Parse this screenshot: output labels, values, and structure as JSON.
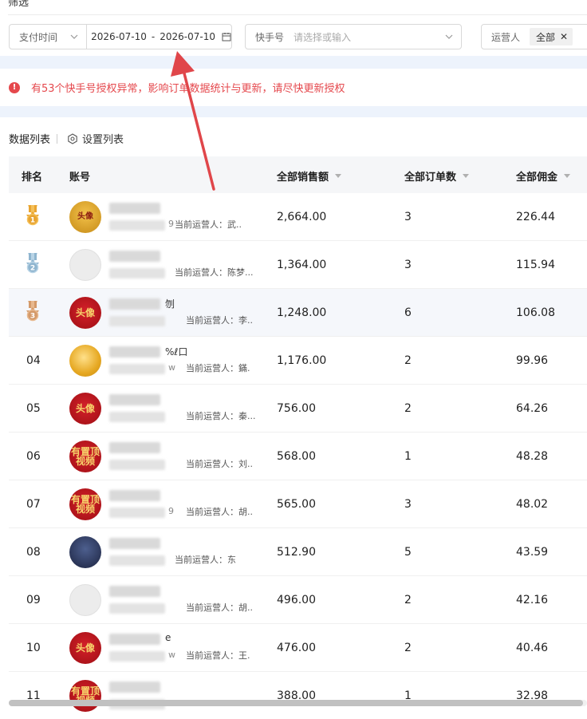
{
  "page": {
    "title": "筛选"
  },
  "filters": {
    "pay_time_label": "支付时间",
    "date_start": "2026-07-10",
    "date_sep": "-",
    "date_end": "2026-07-10",
    "kuaishou_label": "快手号",
    "kuaishou_placeholder": "请选择或输入",
    "operator_label": "运营人",
    "operator_tag": "全部"
  },
  "alert": {
    "text": "有53个快手号授权异常，影响订单数据统计与更新，请尽快更新授权"
  },
  "list": {
    "title": "数据列表",
    "settings_label": "设置列表"
  },
  "table": {
    "headers": {
      "rank": "排名",
      "account": "账号",
      "sales": "全部销售额",
      "orders": "全部订单数",
      "commission": "全部佣金"
    },
    "rows": [
      {
        "rank": "1",
        "name_suffix": "",
        "id_suffix": "9",
        "operator": "当前运营人：武..",
        "sales": "2,664.00",
        "orders": "3",
        "commission": "226.44",
        "avatar": "头像"
      },
      {
        "rank": "2",
        "name_suffix": "",
        "id_suffix": "",
        "operator": "当前运营人：陈梦...",
        "sales": "1,364.00",
        "orders": "3",
        "commission": "115.94",
        "avatar": ""
      },
      {
        "rank": "3",
        "name_suffix": "刎",
        "id_suffix": "",
        "operator": "当前运营人：李..",
        "sales": "1,248.00",
        "orders": "6",
        "commission": "106.08",
        "avatar": "头像"
      },
      {
        "rank": "04",
        "name_suffix": "%ℓ口",
        "id_suffix": "w",
        "operator": "当前运营人：鏋.",
        "sales": "1,176.00",
        "orders": "2",
        "commission": "99.96",
        "avatar": ""
      },
      {
        "rank": "05",
        "name_suffix": "",
        "id_suffix": "",
        "operator": "当前运营人：秦...",
        "sales": "756.00",
        "orders": "2",
        "commission": "64.26",
        "avatar": "头像"
      },
      {
        "rank": "06",
        "name_suffix": "",
        "id_suffix": "",
        "operator": "当前运营人：刘..",
        "sales": "568.00",
        "orders": "1",
        "commission": "48.28",
        "avatar": "有置顶视频"
      },
      {
        "rank": "07",
        "name_suffix": "",
        "id_suffix": "9",
        "operator": "当前运营人：胡..",
        "sales": "565.00",
        "orders": "3",
        "commission": "48.02",
        "avatar": "有置顶视频"
      },
      {
        "rank": "08",
        "name_suffix": "",
        "id_suffix": "",
        "operator": "当前运营人：东",
        "sales": "512.90",
        "orders": "5",
        "commission": "43.59",
        "avatar": ""
      },
      {
        "rank": "09",
        "name_suffix": "",
        "id_suffix": "",
        "operator": "当前运营人：胡..",
        "sales": "496.00",
        "orders": "2",
        "commission": "42.16",
        "avatar": ""
      },
      {
        "rank": "10",
        "name_suffix": "e",
        "id_suffix": "w",
        "operator": "当前运营人：王.",
        "sales": "476.00",
        "orders": "2",
        "commission": "40.46",
        "avatar": "头像"
      },
      {
        "rank": "11",
        "name_suffix": "",
        "id_suffix": "",
        "operator": "",
        "sales": "388.00",
        "orders": "1",
        "commission": "32.98",
        "avatar": "有置顶视频"
      }
    ]
  },
  "colors": {
    "alert": "#e5484d",
    "header_bg": "#f5f6f8",
    "band": "#edf3fc",
    "arrow": "#e0464a"
  }
}
